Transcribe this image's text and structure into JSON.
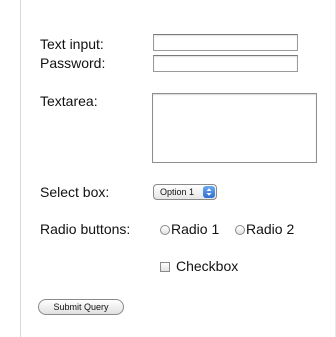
{
  "form": {
    "text_input_label": "Text input:",
    "password_label": "Password:",
    "textarea_label": "Textarea:",
    "select_label": "Select box:",
    "select_value": "Option 1",
    "radio_label": "Radio buttons:",
    "radio_options": [
      "Radio 1",
      "Radio 2"
    ],
    "checkbox_label": "Checkbox",
    "submit_label": "Submit Query"
  },
  "icons": {
    "select_stepper": "up-down-arrows-icon"
  },
  "colors": {
    "stepper_accent": "#3b7fe0"
  }
}
